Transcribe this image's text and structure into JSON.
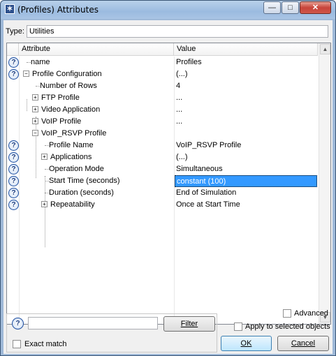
{
  "window": {
    "title": "(Profiles) Attributes",
    "icon": "opnet-star-icon",
    "controls": [
      "minimize",
      "maximize",
      "close"
    ]
  },
  "type_field": {
    "label": "Type:",
    "value": "Utilities"
  },
  "grid": {
    "columns": [
      "Attribute",
      "Value"
    ],
    "rows": [
      {
        "attr": "name",
        "value": "Profiles",
        "help": true
      },
      {
        "attr": "Profile Configuration",
        "value": "(...)",
        "help": true
      },
      {
        "attr": "Number of Rows",
        "value": "4",
        "help": false
      },
      {
        "attr": "FTP Profile",
        "value": "...",
        "help": false
      },
      {
        "attr": "Video Application",
        "value": "...",
        "help": false
      },
      {
        "attr": "VoIP Profile",
        "value": "...",
        "help": false
      },
      {
        "attr": "VoIP_RSVP Profile",
        "value": "",
        "help": false
      },
      {
        "attr": "Profile Name",
        "value": "VoIP_RSVP Profile",
        "help": true
      },
      {
        "attr": "Applications",
        "value": "(...)",
        "help": true
      },
      {
        "attr": "Operation Mode",
        "value": "Simultaneous",
        "help": true
      },
      {
        "attr": "Start Time (seconds)",
        "value": "constant (100)",
        "help": true,
        "selected": true
      },
      {
        "attr": "Duration (seconds)",
        "value": "End of Simulation",
        "help": true
      },
      {
        "attr": "Repeatability",
        "value": "Once at Start Time",
        "help": true
      }
    ]
  },
  "bottom": {
    "help_icon": "?",
    "search_value": "",
    "filter_label": "Filter",
    "exact_match_label": "Exact match",
    "advanced_label": "Advanced",
    "apply_selected_label": "Apply to selected objects",
    "ok_label": "OK",
    "cancel_label": "Cancel"
  },
  "colors": {
    "selection": "#3399ff",
    "title_bar": "#9bbbe0"
  }
}
